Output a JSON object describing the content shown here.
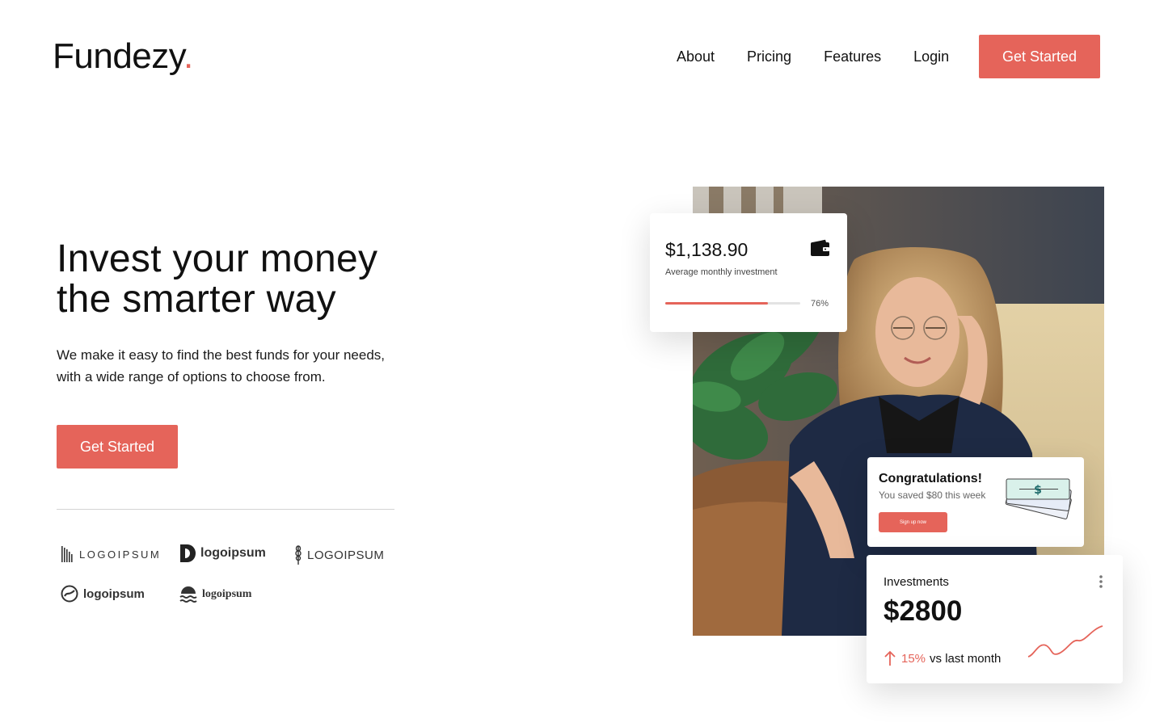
{
  "header": {
    "logo_text": "Fundezy",
    "logo_dot": ".",
    "nav": [
      "About",
      "Pricing",
      "Features",
      "Login"
    ],
    "cta_label": "Get Started"
  },
  "hero": {
    "title_line1": "Invest your money",
    "title_line2": "the smarter way",
    "subtitle_line1": "We make it easy to find the best funds for your needs,",
    "subtitle_line2": "with a wide range of options to choose from.",
    "cta_label": "Get Started"
  },
  "partner_logos": [
    {
      "text": "LOGOIPSUM",
      "icon": "barcode-icon"
    },
    {
      "text": "logoipsum",
      "icon": "half-circle-icon"
    },
    {
      "text": "LOGOIPSUM",
      "icon": "wheat-icon"
    },
    {
      "text": "logoipsum",
      "icon": "circle-slash-icon"
    },
    {
      "text": "logoipsum",
      "icon": "waves-icon"
    }
  ],
  "card_investment": {
    "amount": "$1,138.90",
    "label": "Average monthly investment",
    "progress_percent": 76,
    "progress_label": "76%",
    "icon": "wallet-icon"
  },
  "card_congrats": {
    "title": "Congratulations!",
    "subtitle": "You saved $80 this week",
    "button_label": "Sign up now",
    "icon": "money-bills-icon"
  },
  "card_investments": {
    "title": "Investments",
    "amount": "$2800",
    "change_percent": "15%",
    "change_text": "vs last month",
    "icon": "arrow-up-icon"
  },
  "colors": {
    "accent": "#e5645a",
    "text": "#111111"
  }
}
